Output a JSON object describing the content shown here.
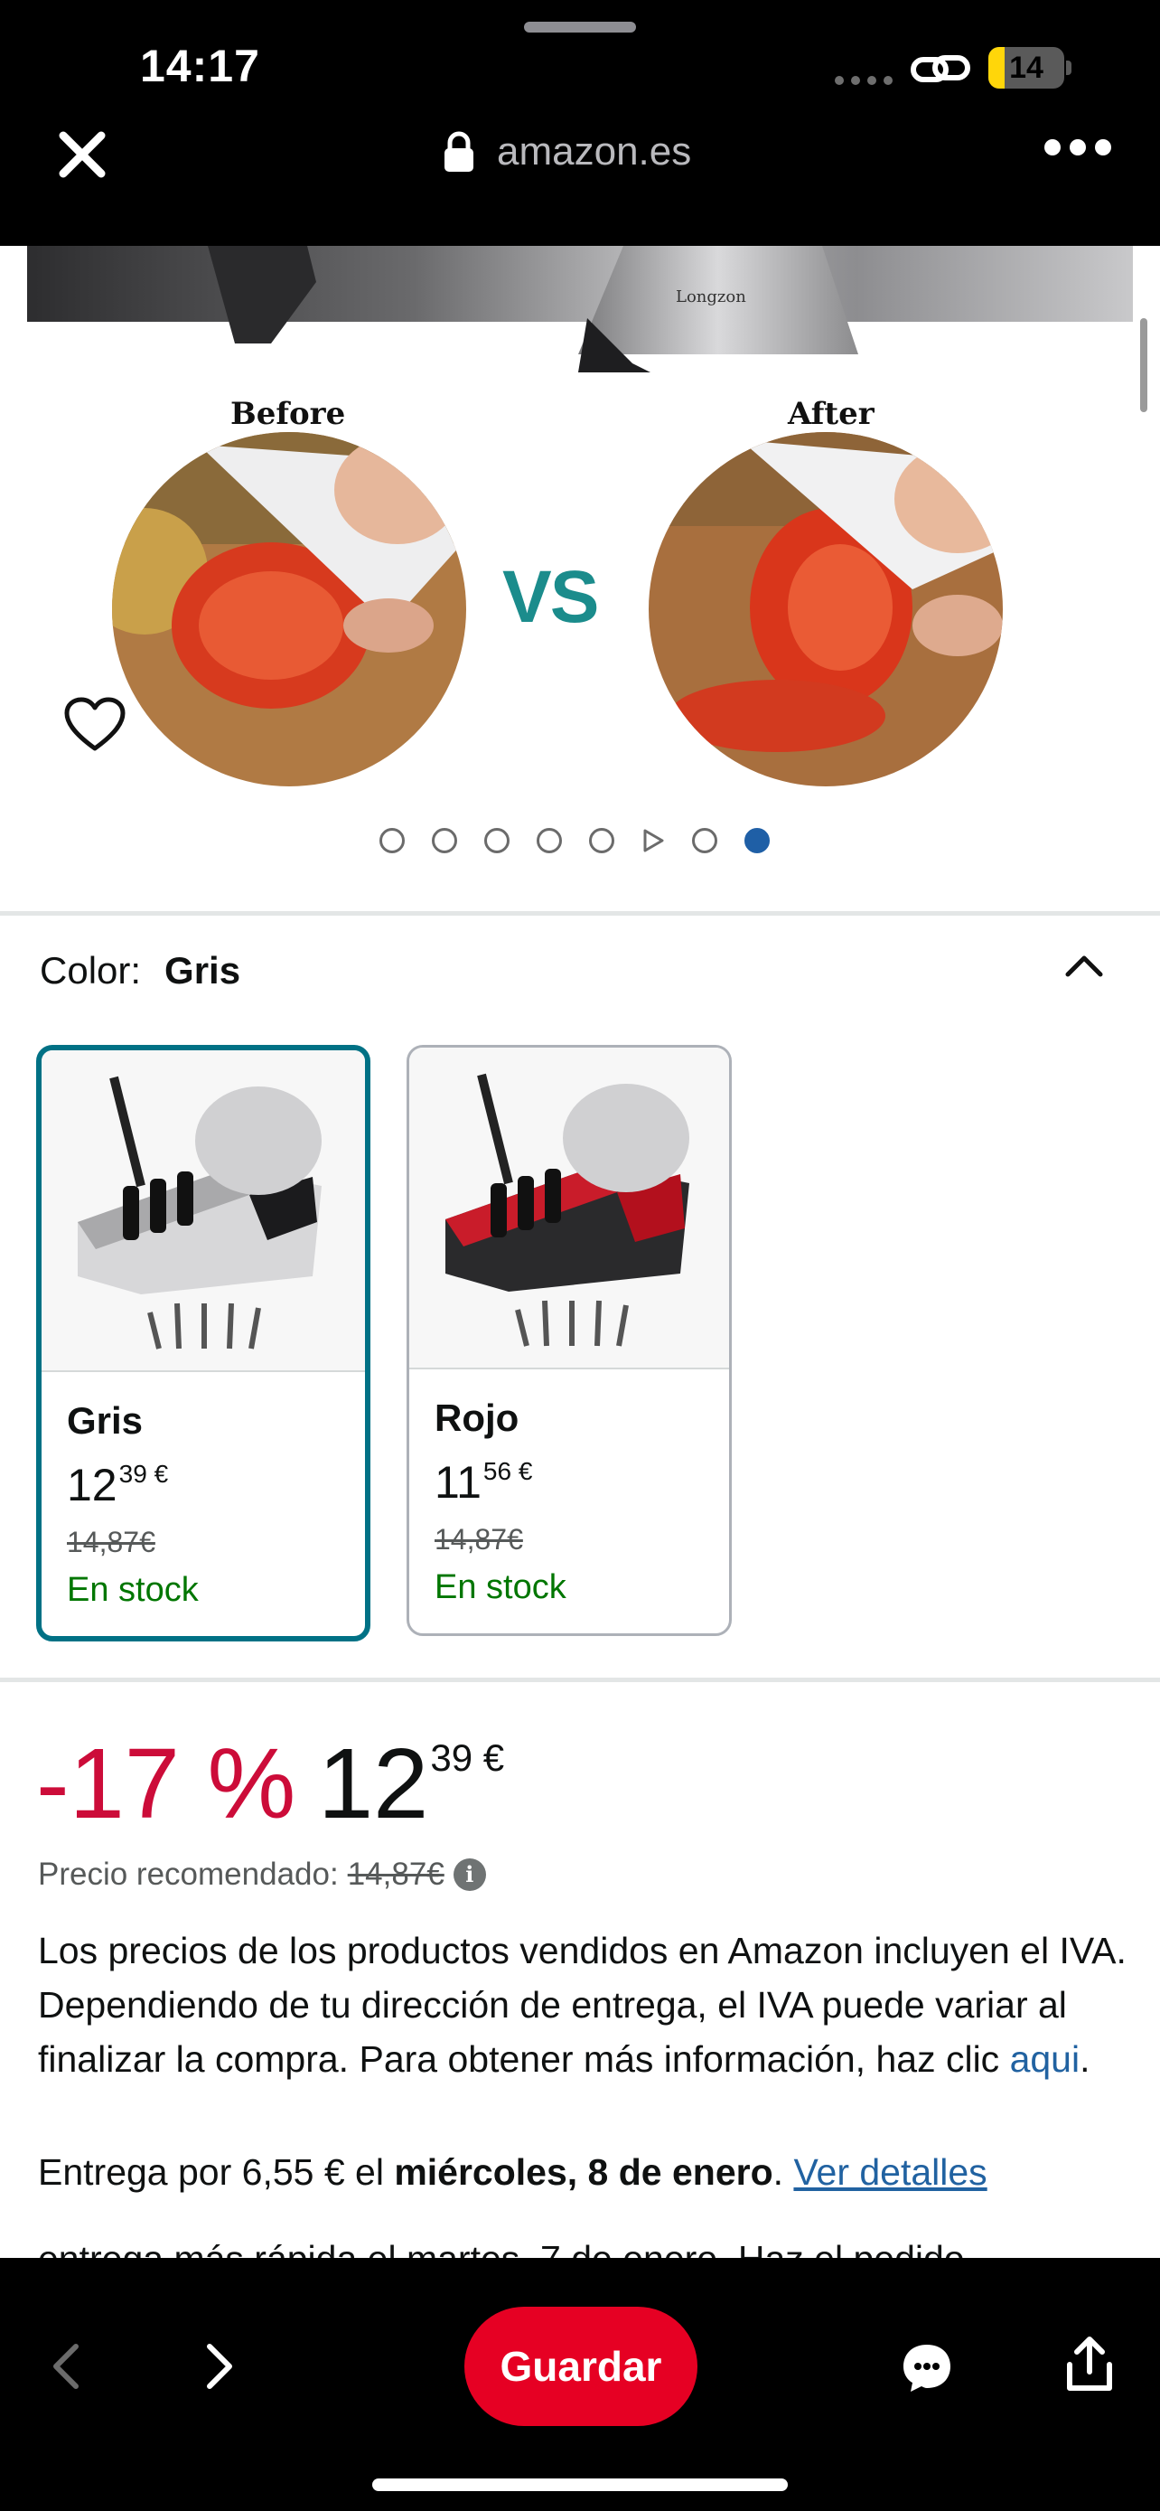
{
  "status_bar": {
    "time": "14:17",
    "battery": "14",
    "battery_level": 0.14
  },
  "browser": {
    "url": "amazon.es",
    "close_icon": "close-icon",
    "lock_icon": "lock-icon",
    "more_icon": "more-icon"
  },
  "hero": {
    "brand": "Longzon",
    "before_label": "Before",
    "after_label": "After",
    "vs_label": "VS",
    "dots_total": 8,
    "active_dot": 8
  },
  "color": {
    "label": "Color:",
    "selected": "Gris",
    "options": [
      {
        "name": "Gris",
        "price_whole": "12",
        "price_fraction": "39",
        "currency": "€",
        "list_price": "14,87€",
        "stock": "En stock",
        "selected": true
      },
      {
        "name": "Rojo",
        "price_whole": "11",
        "price_fraction": "56",
        "currency": "€",
        "list_price": "14,87€",
        "stock": "En stock",
        "selected": false
      }
    ]
  },
  "price": {
    "discount": "-17 %",
    "whole": "12",
    "fraction": "39",
    "currency": "€",
    "recommended_label": "Precio recomendado:",
    "recommended_value": "14,87€"
  },
  "vat_notice": {
    "text": "Los precios de los productos vendidos en Amazon incluyen el IVA. Dependiendo de tu dirección de entrega, el IVA puede variar al finalizar la compra. Para obtener más información, haz clic ",
    "link": "aqui",
    "end": "."
  },
  "delivery": {
    "prefix": "Entrega por 6,55 € el ",
    "date": "miércoles, 8 de enero",
    "sep": ". ",
    "link": "Ver detalles"
  },
  "faster_delivery": "entrega más rápida el martes, 7 de enero. Haz el pedido",
  "bottom_bar": {
    "save_label": "Guardar"
  },
  "colors": {
    "amazon_teal": "#007185",
    "deal_red": "#cc0c39",
    "stock_green": "#007600",
    "save_red": "#e60023",
    "link_blue": "#2162a1"
  }
}
